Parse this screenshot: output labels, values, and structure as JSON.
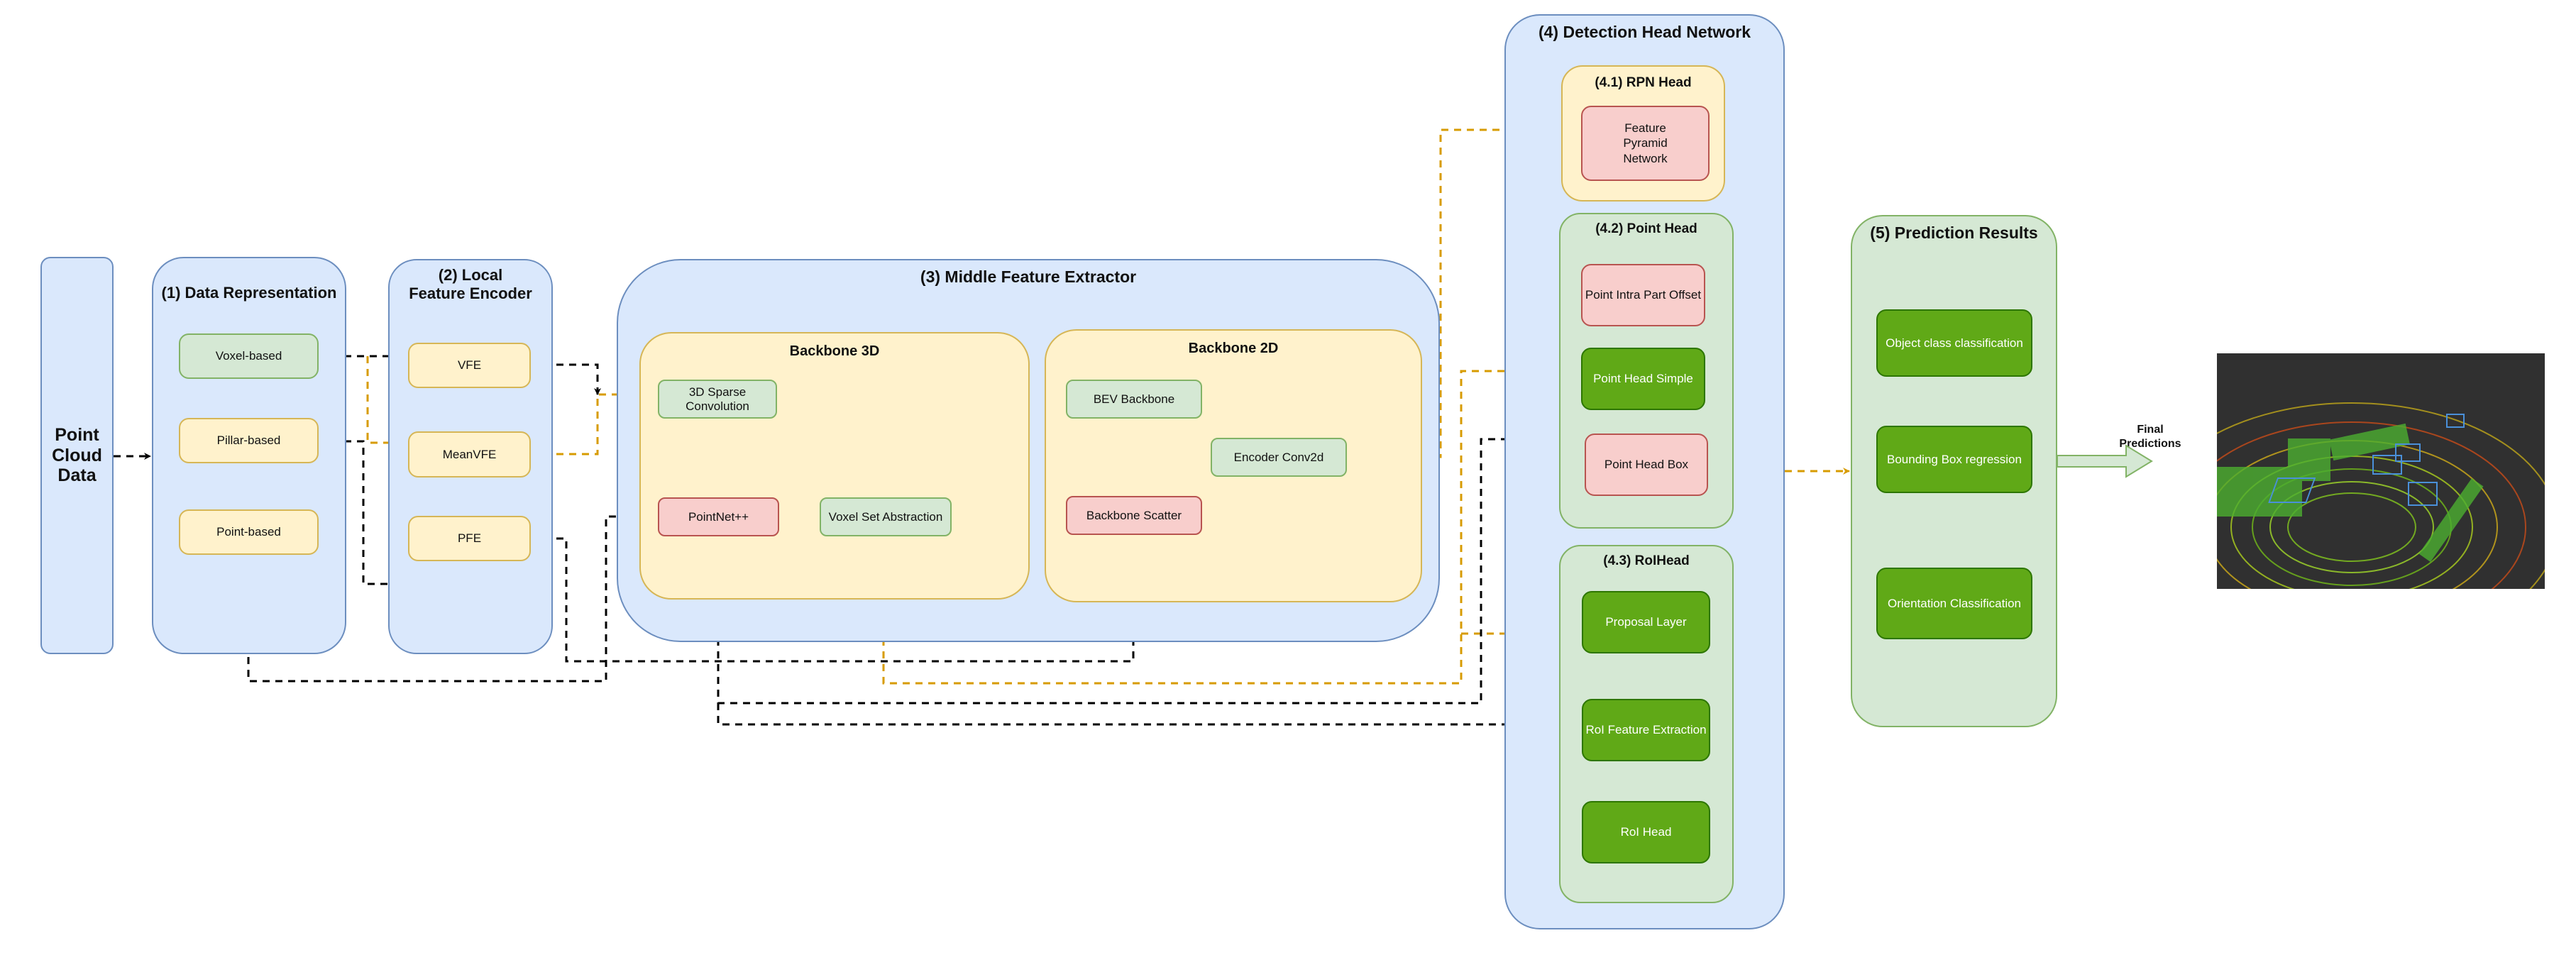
{
  "diagram": {
    "colors": {
      "container_blue": "#dae8fc",
      "container_yellow": "#fff2cc",
      "container_green": "#d5e8d4",
      "node_red": "#f8cecc",
      "node_dark_green": "#60a917",
      "connector_orange": "#d79b00",
      "connector_black": "#000000"
    },
    "input": {
      "label": "Point Cloud Data"
    },
    "stage1": {
      "title": "(1) Data Representation",
      "items": [
        "Voxel-based",
        "Pillar-based",
        "Point-based"
      ]
    },
    "stage2": {
      "title": "(2) Local Feature Encoder",
      "items": [
        "VFE",
        "MeanVFE",
        "PFE"
      ]
    },
    "stage3": {
      "title": "(3) Middle Feature Extractor",
      "backbone3d": {
        "title": "Backbone 3D",
        "items": [
          "3D Sparse Convolution",
          "PointNet++",
          "Voxel Set Abstraction"
        ]
      },
      "backbone2d": {
        "title": "Backbone 2D",
        "items": [
          "BEV Backbone",
          "Encoder Conv2d",
          "Backbone Scatter"
        ]
      }
    },
    "stage4": {
      "title": "(4) Detection Head Network",
      "rpn": {
        "title": "(4.1) RPN Head",
        "items": [
          "Feature Pyramid Network"
        ]
      },
      "point": {
        "title": "(4.2) Point Head",
        "items": [
          "Point Intra Part Offset",
          "Point Head Simple",
          "Point Head Box"
        ]
      },
      "roi": {
        "title": "(4.3) RoIHead",
        "items": [
          "Proposal Layer",
          "RoI Feature Extraction",
          "RoI Head"
        ]
      }
    },
    "stage5": {
      "title": "(5) Prediction Results",
      "items": [
        "Object class classification",
        "Bounding Box regression",
        "Orientation Classification"
      ]
    },
    "output": {
      "arrow_label": "Final Predictions",
      "image_description": "LiDAR point cloud visualization with 3D bounding boxes"
    },
    "connections": [
      {
        "from": "Point Cloud Data",
        "to": "(1) Data Representation",
        "style": "black-dashed"
      },
      {
        "from": "Voxel-based",
        "to": "VFE",
        "style": "black-dashed"
      },
      {
        "from": "Voxel-based",
        "to": "MeanVFE",
        "style": "orange-dashed"
      },
      {
        "from": "Pillar-based",
        "to": "PFE",
        "style": "black-dashed"
      },
      {
        "from": "VFE",
        "to": "3D Sparse Convolution",
        "style": "black-dashed"
      },
      {
        "from": "MeanVFE",
        "to": "3D Sparse Convolution",
        "style": "orange-dashed"
      },
      {
        "from": "PFE",
        "to": "Backbone Scatter",
        "style": "black-dashed"
      },
      {
        "from": "Point-based",
        "to": "PointNet++",
        "style": "black-dashed"
      },
      {
        "from": "3D Sparse Convolution",
        "to": "BEV Backbone",
        "style": "orange-dashed"
      },
      {
        "from": "3D Sparse Convolution",
        "to": "Voxel Set Abstraction",
        "style": "orange-dashed"
      },
      {
        "from": "BEV Backbone",
        "to": "Voxel Set Abstraction",
        "style": "orange-dashed"
      },
      {
        "from": "BEV Backbone",
        "to": "Encoder Conv2d",
        "style": "orange-dashed"
      },
      {
        "from": "Backbone Scatter",
        "to": "Encoder Conv2d",
        "style": "black-dashed"
      },
      {
        "from": "Encoder Conv2d",
        "to": "(4.1) RPN Head",
        "style": "orange-dashed"
      },
      {
        "from": "Voxel Set Abstraction",
        "to": "(4.2) Point Head",
        "style": "orange-dashed"
      },
      {
        "from": "Voxel Set Abstraction",
        "to": "(4.3) RoIHead",
        "style": "orange-dashed"
      },
      {
        "from": "PointNet++",
        "to": "(4.2) Point Head",
        "style": "black-dashed"
      },
      {
        "from": "PointNet++",
        "to": "RoI Feature Extraction",
        "style": "black-dashed"
      },
      {
        "from": "Proposal Layer",
        "to": "RoI Feature Extraction",
        "style": "black-dashed"
      },
      {
        "from": "RoI Feature Extraction",
        "to": "RoI Head",
        "style": "black-dashed"
      },
      {
        "from": "(4) Detection Head Network",
        "to": "(5) Prediction Results",
        "style": "orange-dashed"
      },
      {
        "from": "(5) Prediction Results",
        "to": "output image",
        "style": "block-arrow"
      }
    ]
  }
}
